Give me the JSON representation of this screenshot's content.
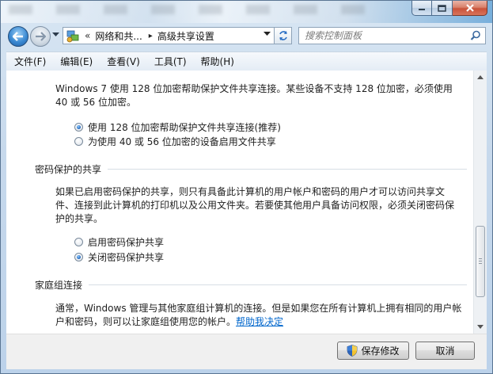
{
  "nav": {
    "breadcrumb_overflow": "«",
    "breadcrumb_parent": "网络和共...",
    "breadcrumb_arrow": "▸",
    "breadcrumb_current": "高级共享设置",
    "search_placeholder": "搜索控制面板"
  },
  "menubar": {
    "items": [
      "文件(F)",
      "编辑(E)",
      "查看(V)",
      "工具(T)",
      "帮助(H)"
    ]
  },
  "content": {
    "encryption_desc": "Windows 7 使用 128 位加密帮助保护文件共享连接。某些设备不支持 128 位加密，必须使用 40 或 56 位加密。",
    "encryption_options": [
      {
        "label": "使用 128 位加密帮助保护文件共享连接(推荐)",
        "selected": true
      },
      {
        "label": "为使用 40 或 56 位加密的设备启用文件共享",
        "selected": false
      }
    ],
    "password_section_title": "密码保护的共享",
    "password_desc": "如果已启用密码保护的共享，则只有具备此计算机的用户帐户和密码的用户才可以访问共享文件、连接到此计算机的打印机以及公用文件夹。若要使其他用户具备访问权限，必须关闭密码保护的共享。",
    "password_options": [
      {
        "label": "启用密码保护共享",
        "selected": false
      },
      {
        "label": "关闭密码保护共享",
        "selected": true
      }
    ],
    "homegroup_section_title": "家庭组连接",
    "homegroup_desc": "通常，Windows 管理与其他家庭组计算机的连接。但是如果您在所有计算机上拥有相同的用户帐户和密码，则可以让家庭组使用您的帐户。",
    "homegroup_link": "帮助我决定"
  },
  "footer": {
    "save_label": "保存修改",
    "cancel_label": "取消"
  },
  "colors": {
    "link": "#0066cc",
    "close_button": "#c9523a"
  }
}
